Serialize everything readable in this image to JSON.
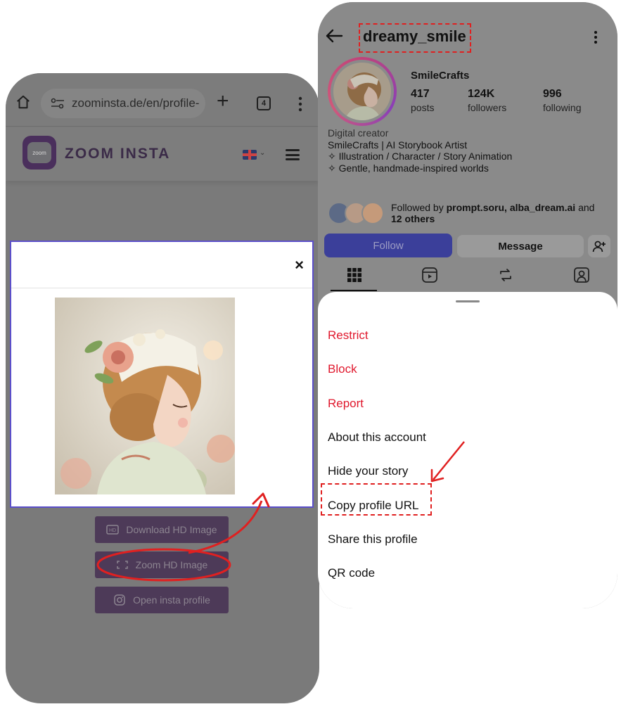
{
  "browser": {
    "url": "zoominsta.de/en/profile-",
    "tab_count": "4"
  },
  "site": {
    "logo_text": "zoom",
    "brand_name": "ZOOM INSTA",
    "language_flag": "uk-flag-icon"
  },
  "modal": {
    "close_glyph": "×"
  },
  "actions": [
    {
      "label": "Download HD Image",
      "icon": "hd-icon"
    },
    {
      "label": "Zoom HD Image",
      "icon": "expand-icon"
    },
    {
      "label": "Open insta profile",
      "icon": "instagram-icon"
    }
  ],
  "instagram": {
    "username": "dreamy_smile",
    "display_name": "SmileCrafts",
    "stats": {
      "posts_count": "417",
      "posts_label": "posts",
      "followers_count": "124K",
      "followers_label": "followers",
      "following_count": "996",
      "following_label": "following"
    },
    "bio": {
      "category": "Digital creator",
      "line1": "SmileCrafts | AI Storybook Artist",
      "line2": "✧ Illustration / Character / Story Animation",
      "line3": "✧ Gentle, handmade-inspired worlds"
    },
    "followed_by": {
      "prefix": "Followed by ",
      "names": "prompt.soru, alba_dream.ai",
      "and": " and",
      "others": "12 others"
    },
    "buttons": {
      "follow": "Follow",
      "message": "Message"
    },
    "tabs": [
      "grid-icon",
      "reels-icon",
      "reposts-icon",
      "tagged-icon"
    ]
  },
  "sheet": {
    "items": [
      {
        "label": "Restrict",
        "danger": true
      },
      {
        "label": "Block",
        "danger": true
      },
      {
        "label": "Report",
        "danger": true
      },
      {
        "label": "About this account",
        "danger": false
      },
      {
        "label": "Hide your story",
        "danger": false
      },
      {
        "label": "Copy profile URL",
        "danger": false
      },
      {
        "label": "Share this profile",
        "danger": false
      },
      {
        "label": "QR code",
        "danger": false
      }
    ]
  },
  "colors": {
    "accent_red": "#e02020",
    "modal_border": "#5b4fc9",
    "danger_text": "#e0182d",
    "follow_blue": "#3b3f9a"
  }
}
